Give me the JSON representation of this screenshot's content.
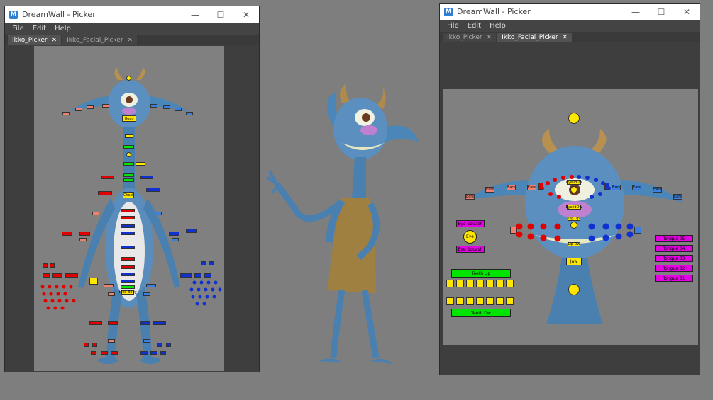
{
  "left_window": {
    "title": "DreamWall - Picker",
    "menu": [
      "File",
      "Edit",
      "Help"
    ],
    "tabs": [
      {
        "label": "Ikko_Picker",
        "active": true
      },
      {
        "label": "Ikko_Facial_Picker",
        "active": false
      }
    ],
    "labels": {
      "head": "Head",
      "chest": "Chest",
      "hips": "Hips Body"
    }
  },
  "right_window": {
    "title": "DreamWall - Picker",
    "menu": [
      "File",
      "Edit",
      "Help"
    ],
    "tabs": [
      {
        "label": "Ikko_Picker",
        "active": false
      },
      {
        "label": "Ikko_Facial_Picker",
        "active": true
      }
    ],
    "labels": {
      "eye_squash_top": "Eye Squash",
      "eye": "Eye",
      "eye_squash_bottom": "Eye Squash",
      "teeth_up": "Teeth Up",
      "teeth_dw": "Teeth Dw",
      "eyelid_up": "EyelidUp",
      "eyelid_dw": "EyelidDw",
      "lip_up": "Lip Up",
      "lip_dw": "Lip Dw",
      "jaw": "Jaw",
      "ear_labels": [
        "Ears",
        "Ears",
        "Ears",
        "Ears",
        "Ears",
        "Ears",
        "Ears",
        "Ears"
      ],
      "tongue": [
        "Tongue 05",
        "Tongue 04",
        "Tongue 03",
        "Tongue 02",
        "Tongue 01"
      ]
    }
  },
  "colors": {
    "yellow": "#ffe600",
    "green": "#00e400",
    "magenta": "#e600e6",
    "red": "#e00000",
    "blue": "#1030d0",
    "salmon": "#f08070",
    "lightblue": "#3b80e0"
  }
}
